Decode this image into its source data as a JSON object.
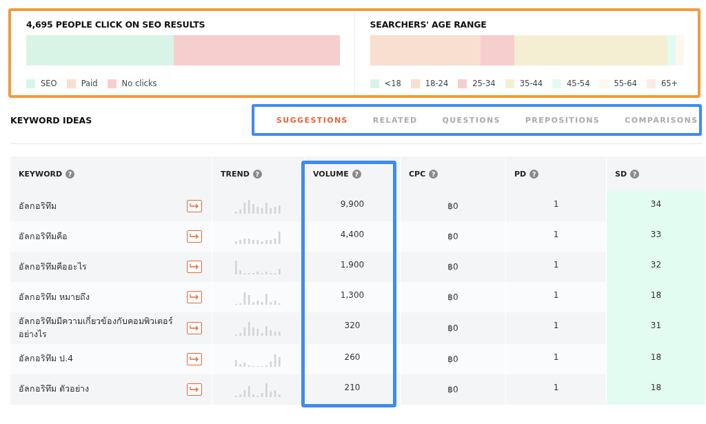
{
  "clicks_panel": {
    "title": "4,695 PEOPLE CLICK ON SEO RESULTS",
    "legend": [
      {
        "label": "SEO",
        "color": "#d8f4e6"
      },
      {
        "label": "Paid",
        "color": "#f9dfcf"
      },
      {
        "label": "No clicks",
        "color": "#f6cece"
      }
    ]
  },
  "age_panel": {
    "title": "SEARCHERS' AGE RANGE",
    "legend": [
      {
        "label": "<18",
        "color": "#d8f4e6"
      },
      {
        "label": "18-24",
        "color": "#f9dfcf"
      },
      {
        "label": "25-34",
        "color": "#f6cece"
      },
      {
        "label": "35-44",
        "color": "#f4efd2"
      },
      {
        "label": "45-54",
        "color": "#e2fbf0"
      },
      {
        "label": "55-64",
        "color": "#fdf7ec"
      },
      {
        "label": "65+",
        "color": "#fbeaea"
      }
    ]
  },
  "keyword_ideas": {
    "title": "KEYWORD IDEAS",
    "tabs": [
      {
        "label": "SUGGESTIONS",
        "selected": true
      },
      {
        "label": "RELATED",
        "selected": false
      },
      {
        "label": "QUESTIONS",
        "selected": false
      },
      {
        "label": "PREPOSITIONS",
        "selected": false
      },
      {
        "label": "COMPARISONS",
        "selected": false
      }
    ]
  },
  "table": {
    "columns": [
      {
        "label": "KEYWORD",
        "help": "?"
      },
      {
        "label": "TREND",
        "help": "?"
      },
      {
        "label": "VOLUME",
        "help": "?"
      },
      {
        "label": "CPC",
        "help": "?"
      },
      {
        "label": "PD",
        "help": "?"
      },
      {
        "label": "SD",
        "help": "?"
      }
    ],
    "rows": [
      {
        "keyword": "อัลกอริทึม",
        "volume": "9,900",
        "cpc": "฿0",
        "pd": "1",
        "sd": "34"
      },
      {
        "keyword": "อัลกอริทึมคือ",
        "volume": "4,400",
        "cpc": "฿0",
        "pd": "1",
        "sd": "33"
      },
      {
        "keyword": "อัลกอริทึมคืออะไร",
        "volume": "1,900",
        "cpc": "฿0",
        "pd": "1",
        "sd": "32"
      },
      {
        "keyword": "อัลกอริทึม หมายถึง",
        "volume": "1,300",
        "cpc": "฿0",
        "pd": "1",
        "sd": "18"
      },
      {
        "keyword": "อัลกอริทึมมีความเกี่ยวข้องกับคอมพิวเตอร์อย่างไร",
        "volume": "320",
        "cpc": "฿0",
        "pd": "1",
        "sd": "31"
      },
      {
        "keyword": "อัลกอริทึม ป.4",
        "volume": "260",
        "cpc": "฿0",
        "pd": "1",
        "sd": "18"
      },
      {
        "keyword": "อัลกอริทึม ตัวอย่าง",
        "volume": "210",
        "cpc": "฿0",
        "pd": "1",
        "sd": "18"
      }
    ]
  }
}
